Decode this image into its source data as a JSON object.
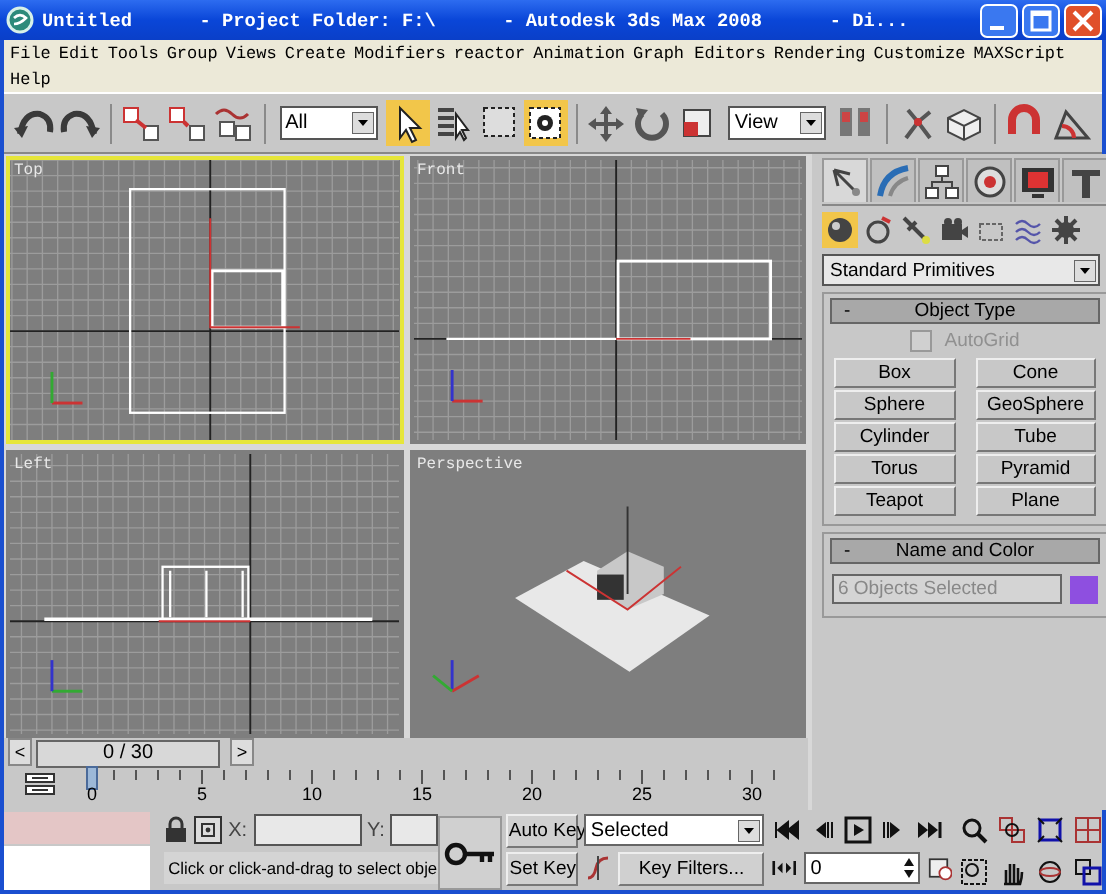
{
  "window": {
    "title": "Untitled      - Project Folder: F:\\      - Autodesk 3ds Max 2008      - Di..."
  },
  "menu": [
    "File",
    "Edit",
    "Tools",
    "Group",
    "Views",
    "Create",
    "Modifiers",
    "reactor",
    "Animation",
    "Graph Editors",
    "Rendering",
    "Customize",
    "MAXScript",
    "Help"
  ],
  "toolbar": [
    {
      "kind": "undo",
      "selected": false
    },
    {
      "kind": "redo",
      "selected": false
    },
    {
      "kind": "separator"
    },
    {
      "kind": "link",
      "selected": false
    },
    {
      "kind": "unlink",
      "selected": false
    },
    {
      "kind": "bind",
      "selected": false
    },
    {
      "kind": "separator"
    },
    {
      "kind": "dropdown",
      "value": "All"
    },
    {
      "kind": "select",
      "selected": true
    },
    {
      "kind": "select-by-name",
      "selected": false
    },
    {
      "kind": "region",
      "selected": false
    },
    {
      "kind": "crossing",
      "selected": true
    },
    {
      "kind": "separator"
    },
    {
      "kind": "move",
      "selected": false
    },
    {
      "kind": "rotate",
      "selected": false
    },
    {
      "kind": "scale",
      "selected": false
    },
    {
      "kind": "dropdown",
      "value": "View"
    },
    {
      "kind": "pivot",
      "selected": false
    },
    {
      "kind": "separator"
    },
    {
      "kind": "manipulate",
      "selected": false
    },
    {
      "kind": "box",
      "selected": false
    },
    {
      "kind": "separator"
    },
    {
      "kind": "snap",
      "selected": false
    },
    {
      "kind": "angle-snap",
      "selected": false
    }
  ],
  "viewports": [
    {
      "kind": "top",
      "label": "Top",
      "active": true
    },
    {
      "kind": "front",
      "label": "Front",
      "active": false
    },
    {
      "kind": "left",
      "label": "Left",
      "active": false
    },
    {
      "kind": "perspective",
      "label": "Perspective",
      "active": false
    }
  ],
  "time_slider": {
    "prev": "<",
    "label": "0 / 30",
    "next": ">",
    "level": 0
  },
  "trackbar": {
    "ticks": [
      "0",
      "5",
      "10",
      "15",
      "20",
      "25",
      "30"
    ]
  },
  "command_panel": {
    "tabs": [
      {
        "kind": "create",
        "selected": true
      },
      {
        "kind": "modify",
        "selected": false
      },
      {
        "kind": "hierarchy",
        "selected": false
      },
      {
        "kind": "motion",
        "selected": false
      },
      {
        "kind": "display",
        "selected": false
      },
      {
        "kind": "utilities",
        "selected": false
      }
    ],
    "categories": [
      {
        "kind": "geometry",
        "selected": true
      },
      {
        "kind": "shapes",
        "selected": false
      },
      {
        "kind": "lights",
        "selected": false
      },
      {
        "kind": "cameras",
        "selected": false
      },
      {
        "kind": "helpers",
        "selected": false
      },
      {
        "kind": "space-warps",
        "selected": false
      },
      {
        "kind": "systems",
        "selected": false
      }
    ],
    "dropdown": "Standard Primitives",
    "object_type": {
      "toggle": "-",
      "title": "Object Type",
      "autogrid": {
        "label": "AutoGrid",
        "checked": false,
        "disabled": true
      },
      "buttons": [
        "Box",
        "Cone",
        "Sphere",
        "GeoSphere",
        "Cylinder",
        "Tube",
        "Torus",
        "Pyramid",
        "Teapot",
        "Plane"
      ]
    },
    "name_and_color": {
      "toggle": "-",
      "title": "Name and Color",
      "value": "6 Objects Selected",
      "color": "#8e4fe0"
    }
  },
  "status": {
    "x_label": "X:",
    "y_label": "Y:",
    "prompt": "Click or click-and-drag to select obje",
    "auto_key": "Auto Key",
    "set_key": "Set Key",
    "key_mode": "Selected",
    "key_filters": "Key Filters...",
    "frame": "0"
  }
}
